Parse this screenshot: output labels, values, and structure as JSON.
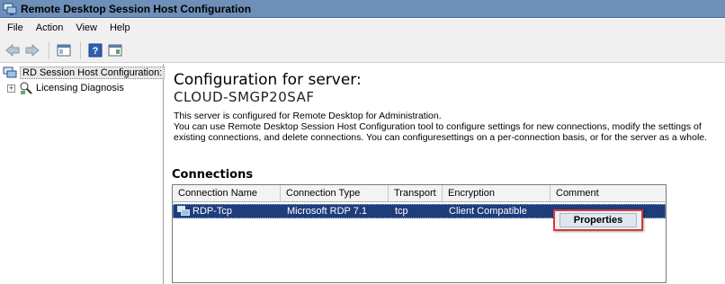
{
  "window": {
    "title": "Remote Desktop Session Host Configuration",
    "titlebar_color": "#6d8fb8"
  },
  "menu": {
    "items": [
      "File",
      "Action",
      "View",
      "Help"
    ]
  },
  "toolbar": {
    "buttons": [
      "back-arrow-icon",
      "forward-arrow-icon",
      "show-hide-console-tree-icon",
      "help-icon",
      "action-pane-icon"
    ]
  },
  "tree": {
    "root_label": "RD Session Host Configuration:",
    "child_label": "Licensing Diagnosis",
    "child_expander": "+"
  },
  "main": {
    "heading": "Configuration for server:",
    "server_name": "CLOUD-SMGP20SAF",
    "description": [
      "This server is configured for Remote Desktop for Administration.",
      "You can use Remote Desktop Session Host Configuration tool to configure settings for new connections, modify the settings of existing connections, and delete connections. You can configuresettings on a per-connection basis, or for the server as a whole."
    ],
    "connections_title": "Connections",
    "columns": [
      "Connection Name",
      "Connection Type",
      "Transport",
      "Encryption",
      "Comment"
    ],
    "rows": [
      {
        "name": "RDP-Tcp",
        "type": "Microsoft RDP 7.1",
        "transport": "tcp",
        "encryption": "Client Compatible",
        "comment": ""
      }
    ],
    "selected_row_color": "#1e3d7a"
  },
  "context_menu": {
    "item": "Properties",
    "highlight_color": "#d63a3a"
  }
}
